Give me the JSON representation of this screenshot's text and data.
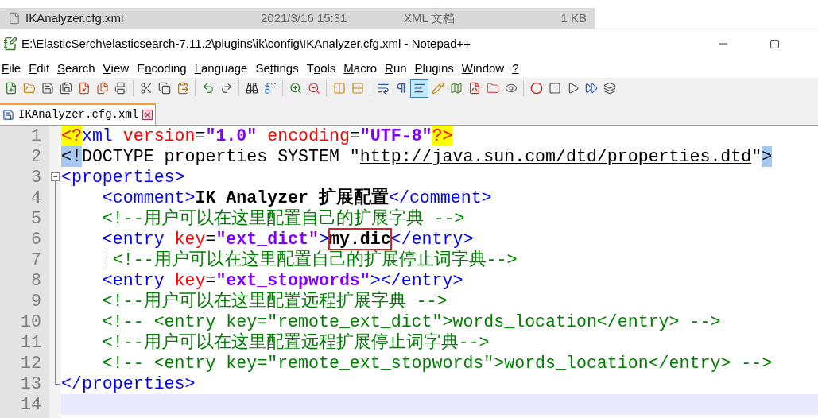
{
  "explorer_row": {
    "selected": true,
    "name": "IKAnalyzer.cfg.xml",
    "date": "2021/3/16 15:31",
    "type": "XML 文档",
    "size": "1 KB"
  },
  "window": {
    "title": "E:\\ElasticSerch\\elasticsearch-7.11.2\\plugins\\ik\\config\\IKAnalyzer.cfg.xml - Notepad++"
  },
  "menu": [
    {
      "key": "F",
      "after": "ile"
    },
    {
      "key": "E",
      "after": "dit"
    },
    {
      "key": "S",
      "after": "earch"
    },
    {
      "key": "V",
      "after": "iew"
    },
    {
      "before": "E",
      "key": "n",
      "after": "coding"
    },
    {
      "key": "L",
      "after": "anguage"
    },
    {
      "before": "Se",
      "key": "t",
      "after": "tings"
    },
    {
      "before": "T",
      "key": "o",
      "after": "ols"
    },
    {
      "key": "M",
      "after": "acro"
    },
    {
      "key": "R",
      "after": "un"
    },
    {
      "key": "P",
      "after": "lugins"
    },
    {
      "key": "W",
      "after": "indow"
    },
    {
      "key": "?"
    }
  ],
  "toolbar": [
    {
      "buttons": [
        {
          "kind": "new",
          "selected": false
        },
        {
          "kind": "open",
          "selected": false
        },
        {
          "kind": "save",
          "selected": false
        },
        {
          "kind": "save-all",
          "selected": false
        },
        {
          "kind": "close",
          "selected": false
        },
        {
          "kind": "close-all",
          "selected": false
        },
        {
          "kind": "print",
          "selected": false
        }
      ]
    },
    {
      "buttons": [
        {
          "kind": "cut",
          "selected": false
        },
        {
          "kind": "copy",
          "selected": false
        },
        {
          "kind": "paste",
          "selected": false
        }
      ]
    },
    {
      "buttons": [
        {
          "kind": "undo",
          "selected": false
        },
        {
          "kind": "redo",
          "selected": false
        }
      ]
    },
    {
      "buttons": [
        {
          "kind": "find",
          "selected": false
        },
        {
          "kind": "replace",
          "selected": false
        }
      ]
    },
    {
      "buttons": [
        {
          "kind": "zoom-in",
          "selected": false
        },
        {
          "kind": "zoom-out",
          "selected": false
        }
      ]
    },
    {
      "buttons": [
        {
          "kind": "sync-v",
          "selected": false
        },
        {
          "kind": "sync-h",
          "selected": false
        }
      ]
    },
    {
      "buttons": [
        {
          "kind": "wrap",
          "selected": false
        },
        {
          "kind": "all-chars",
          "selected": false
        },
        {
          "kind": "indent-guide",
          "selected": true
        },
        {
          "kind": "language",
          "selected": false
        },
        {
          "kind": "doc-map",
          "selected": false
        },
        {
          "kind": "function-list",
          "selected": false
        },
        {
          "kind": "folder",
          "selected": false
        },
        {
          "kind": "monitor",
          "selected": false
        }
      ]
    },
    {
      "buttons": [
        {
          "kind": "record",
          "selected": false
        },
        {
          "kind": "stop",
          "selected": false
        },
        {
          "kind": "play",
          "selected": false
        },
        {
          "kind": "play-multiple",
          "selected": false
        },
        {
          "kind": "save-macro",
          "selected": false
        }
      ]
    }
  ],
  "tabs": [
    {
      "label": "IKAnalyzer.cfg.xml",
      "selected": true
    }
  ],
  "editor": {
    "lines": [
      {
        "number": "1",
        "current": false,
        "kind": "plain",
        "indent_guide": false,
        "tokens": [
          {
            "kind": "pi",
            "text": "<?"
          },
          {
            "kind": "tag",
            "text": "xml"
          },
          {
            "kind": "attr",
            "text": " version"
          },
          {
            "kind": "plain",
            "text": "="
          },
          {
            "kind": "value",
            "text": "\"1.0\""
          },
          {
            "kind": "attr",
            "text": " encoding"
          },
          {
            "kind": "plain",
            "text": "="
          },
          {
            "kind": "value",
            "text": "\"UTF-8\""
          },
          {
            "kind": "pi",
            "text": "?>"
          }
        ]
      },
      {
        "number": "2",
        "current": false,
        "kind": "plain",
        "indent_guide": false,
        "tokens": [
          {
            "kind": "match",
            "text": "<!"
          },
          {
            "kind": "plain",
            "text": "DOCTYPE properties SYSTEM \""
          },
          {
            "kind": "url",
            "text": "http://java.sun.com/dtd/properties.dtd"
          },
          {
            "kind": "plain",
            "text": "\""
          },
          {
            "kind": "match",
            "text": ">"
          }
        ]
      },
      {
        "number": "3",
        "current": false,
        "kind": "fold-start",
        "indent_guide": false,
        "tokens": [
          {
            "kind": "tag",
            "text": "<properties>"
          }
        ]
      },
      {
        "number": "4",
        "current": false,
        "kind": "fold-body",
        "indent_guide": false,
        "tokens": [
          {
            "kind": "tag",
            "text": "    <comment>"
          },
          {
            "kind": "text",
            "text": "IK Analyzer 扩展配置"
          },
          {
            "kind": "tag",
            "text": "</comment>"
          }
        ]
      },
      {
        "number": "5",
        "current": false,
        "kind": "fold-body",
        "indent_guide": false,
        "tokens": [
          {
            "kind": "comment",
            "text": "    <!--用户可以在这里配置自己的扩展字典 -->"
          }
        ]
      },
      {
        "number": "6",
        "current": false,
        "kind": "fold-body",
        "indent_guide": false,
        "tokens": [
          {
            "kind": "tag",
            "text": "    <entry "
          },
          {
            "kind": "attr",
            "text": "key"
          },
          {
            "kind": "plain",
            "text": "="
          },
          {
            "kind": "value",
            "text": "\"ext_dict\""
          },
          {
            "kind": "tag",
            "text": ">"
          },
          {
            "kind": "boxed",
            "text": "my.dic"
          },
          {
            "kind": "tag",
            "text": "</entry>"
          }
        ]
      },
      {
        "number": "7",
        "current": false,
        "kind": "fold-body",
        "indent_guide": true,
        "tokens": [
          {
            "kind": "comment",
            "text": "<!--用户可以在这里配置自己的扩展停止词字典-->"
          }
        ]
      },
      {
        "number": "8",
        "current": false,
        "kind": "fold-body",
        "indent_guide": false,
        "tokens": [
          {
            "kind": "tag",
            "text": "    <entry "
          },
          {
            "kind": "attr",
            "text": "key"
          },
          {
            "kind": "plain",
            "text": "="
          },
          {
            "kind": "value",
            "text": "\"ext_stopwords\""
          },
          {
            "kind": "tag",
            "text": "></entry>"
          }
        ]
      },
      {
        "number": "9",
        "current": false,
        "kind": "fold-body",
        "indent_guide": false,
        "tokens": [
          {
            "kind": "comment",
            "text": "    <!--用户可以在这里配置远程扩展字典 -->"
          }
        ]
      },
      {
        "number": "10",
        "current": false,
        "kind": "fold-body",
        "indent_guide": false,
        "tokens": [
          {
            "kind": "comment",
            "text": "    <!-- <entry key=\"remote_ext_dict\">words_location</entry> -->"
          }
        ]
      },
      {
        "number": "11",
        "current": false,
        "kind": "fold-body",
        "indent_guide": false,
        "tokens": [
          {
            "kind": "comment",
            "text": "    <!--用户可以在这里配置远程扩展停止词字典-->"
          }
        ]
      },
      {
        "number": "12",
        "current": false,
        "kind": "fold-body",
        "indent_guide": false,
        "tokens": [
          {
            "kind": "comment",
            "text": "    <!-- <entry key=\"remote_ext_stopwords\">words_location</entry> -->"
          }
        ]
      },
      {
        "number": "13",
        "current": false,
        "kind": "fold-end",
        "indent_guide": false,
        "tokens": [
          {
            "kind": "tag",
            "text": "</properties>"
          }
        ]
      },
      {
        "number": "14",
        "current": true,
        "kind": "plain",
        "indent_guide": false
      }
    ]
  }
}
